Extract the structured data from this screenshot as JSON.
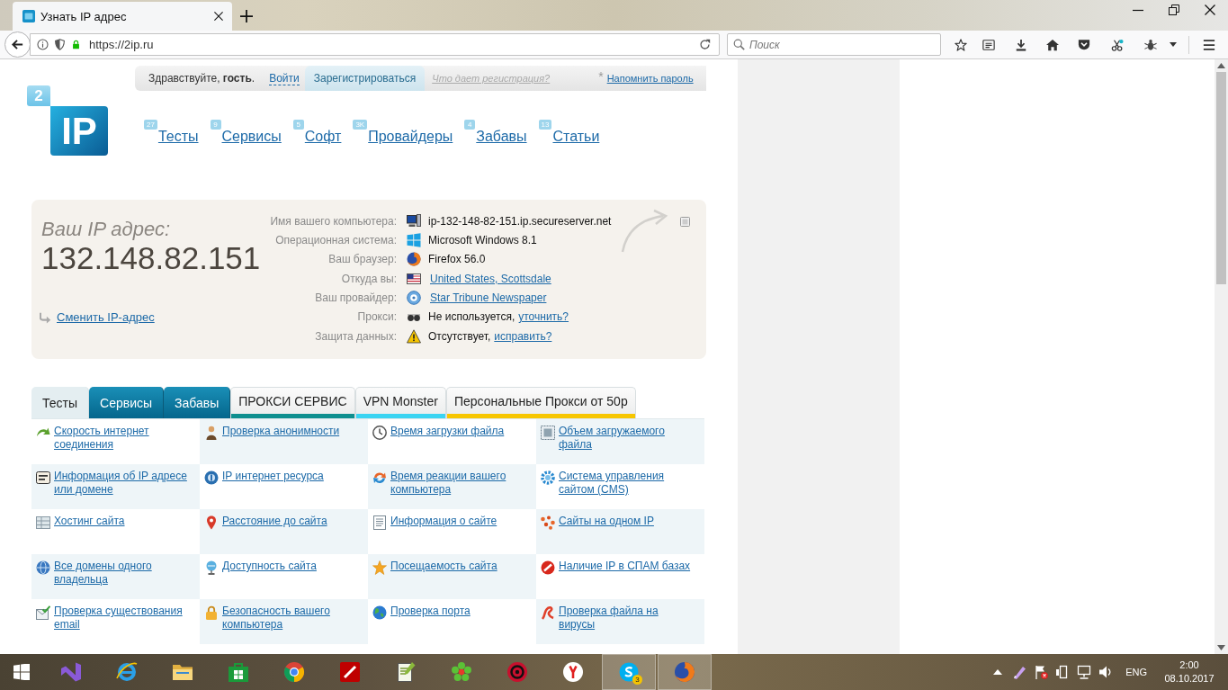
{
  "browser": {
    "tab": {
      "title": "Узнать IP адрес"
    },
    "address": "https://2ip.ru",
    "search": {
      "placeholder": "Поиск"
    }
  },
  "greeting": {
    "text": "Здравствуйте, **гость**.",
    "login": "Войти",
    "register": "Зарегистрироваться",
    "why_register": "Что дает регистрация?",
    "asterisk": "*",
    "remind_password": "Напомнить пароль"
  },
  "logo": {
    "badge": "2",
    "mark": "IP"
  },
  "nav": [
    {
      "label": "Тесты",
      "count": "27"
    },
    {
      "label": "Сервисы",
      "count": "9"
    },
    {
      "label": "Софт",
      "count": "5"
    },
    {
      "label": "Провайдеры",
      "count": "3K"
    },
    {
      "label": "Забавы",
      "count": "4"
    },
    {
      "label": "Статьи",
      "count": "13"
    }
  ],
  "ip_card": {
    "title": "Ваш IP адрес:",
    "ip": "132.148.82.151",
    "change_link": "Сменить IP-адрес",
    "details": [
      {
        "label": "Имя вашего компьютера:",
        "text": "ip-132-148-82-151.ip.secureserver.net"
      },
      {
        "label": "Операционная система:",
        "text": "Microsoft Windows 8.1"
      },
      {
        "label": "Ваш браузер:",
        "text": "Firefox 56.0"
      },
      {
        "label": "Откуда вы:",
        "link": "United States, Scottsdale"
      },
      {
        "label": "Ваш провайдер:",
        "link": "Star Tribune Newspaper"
      },
      {
        "label": "Прокси:",
        "text": "Не используется,",
        "link": "уточнить?"
      },
      {
        "label": "Защита данных:",
        "text": "Отсутствует,",
        "link": "исправить?"
      }
    ]
  },
  "tabs": [
    {
      "label": "Тесты",
      "kind": "section",
      "selected": true
    },
    {
      "label": "Сервисы",
      "kind": "section",
      "selected": false
    },
    {
      "label": "Забавы",
      "kind": "section",
      "selected": false
    },
    {
      "label": "ПРОКСИ СЕРВИС",
      "kind": "promo",
      "selected": false,
      "color": "#0e8f8f"
    },
    {
      "label": "VPN Monster",
      "kind": "promo",
      "selected": false,
      "color": "#3ad4f2"
    },
    {
      "label": "Персональные Прокси от 50р",
      "kind": "promo",
      "selected": false,
      "color": "#f7c600"
    }
  ],
  "links": [
    "Скорость интернет соединения",
    "Проверка анонимности",
    "Время загрузки файла",
    "Объем загружаемого файла",
    "Информация об IP адресе или домене",
    "IP интернет ресурса",
    "Время реакции вашего компьютера",
    "Система управления сайтом (CMS)",
    "Хостинг сайта",
    "Расстояние до сайта",
    "Информация о сайте",
    "Сайты на одном IP",
    "Все домены одного владельца",
    "Доступность сайта",
    "Посещаемость сайта",
    "Наличие IP в СПАМ базах",
    "Проверка существования email",
    "Безопасность вашего компьютера",
    "Проверка порта",
    "Проверка файла на вирусы"
  ],
  "taskbar": {
    "apps": [
      {
        "running": false
      },
      {
        "running": false
      },
      {
        "running": false
      },
      {
        "running": false
      },
      {
        "running": false
      },
      {
        "running": false
      },
      {
        "running": false
      },
      {
        "running": false
      },
      {
        "running": false
      },
      {
        "running": false
      },
      {
        "running": true,
        "badge": "3"
      },
      {
        "running": true
      }
    ],
    "language": "ENG",
    "time": "2:00",
    "date": "08.10.2017"
  }
}
